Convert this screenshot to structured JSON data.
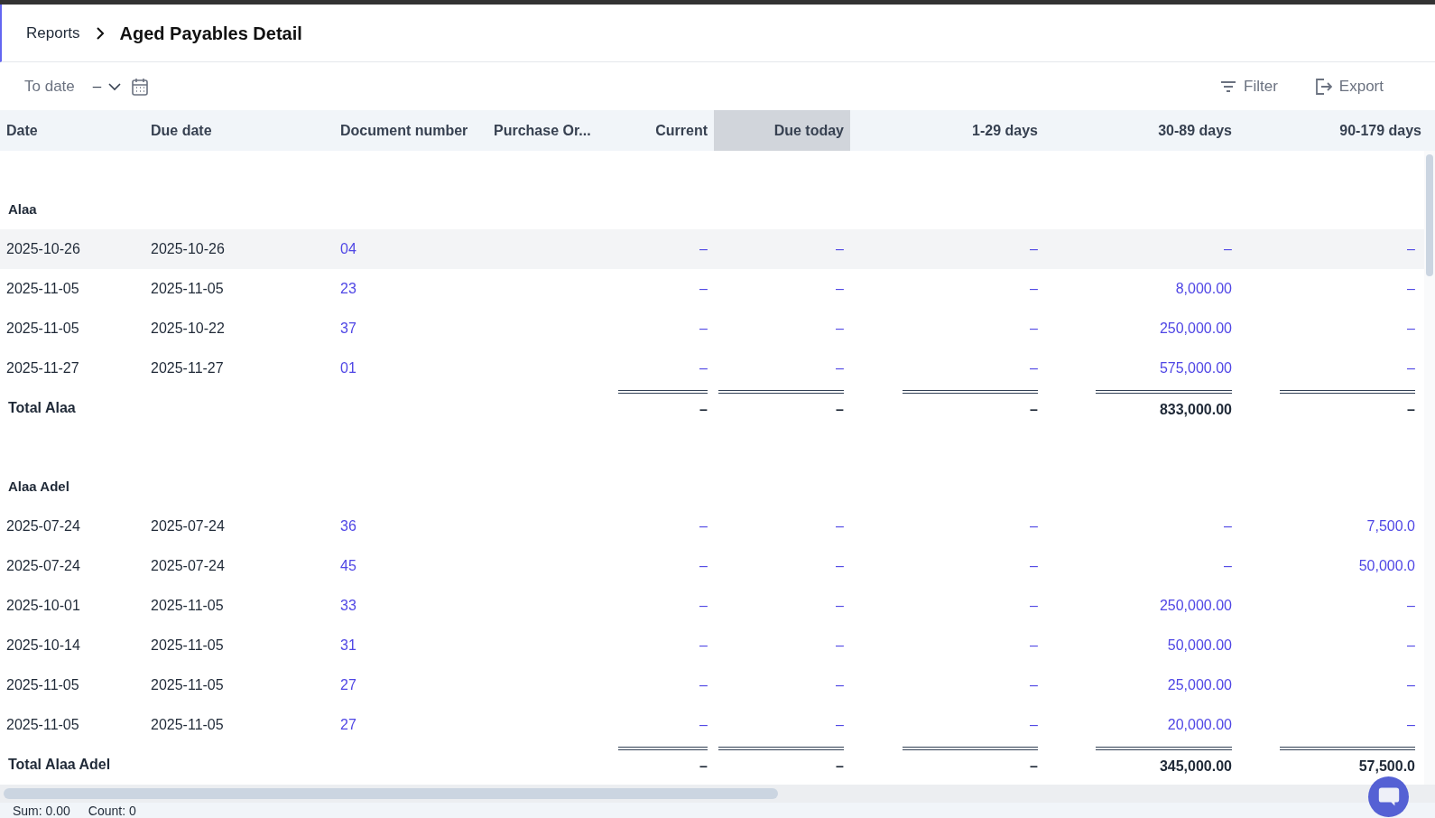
{
  "breadcrumb": {
    "parent": "Reports",
    "current": "Aged Payables Detail"
  },
  "toolbar": {
    "date_label": "To date",
    "date_value": "–",
    "filter": "Filter",
    "export": "Export"
  },
  "table": {
    "columns": [
      {
        "label": "Date",
        "kind": "text",
        "highlighted": false
      },
      {
        "label": "Due date",
        "kind": "text",
        "highlighted": false
      },
      {
        "label": "Document number",
        "kind": "text",
        "highlighted": false
      },
      {
        "label": "Purchase Or...",
        "kind": "text",
        "highlighted": false
      },
      {
        "label": "Current",
        "kind": "amount",
        "highlighted": false
      },
      {
        "label": "Due today",
        "kind": "amount",
        "highlighted": true
      },
      {
        "label": "1-29 days",
        "kind": "amount",
        "highlighted": false
      },
      {
        "label": "30-89 days",
        "kind": "amount",
        "highlighted": false
      },
      {
        "label": "90-179 days",
        "kind": "amount",
        "highlighted": false
      }
    ],
    "groups": [
      {
        "name": "Alaa",
        "rows": [
          {
            "date": "2025-10-26",
            "due_date": "2025-10-26",
            "document_number": "04",
            "selected": true,
            "amounts": [
              "–",
              "–",
              "–",
              "–",
              "–"
            ]
          },
          {
            "date": "2025-11-05",
            "due_date": "2025-11-05",
            "document_number": "23",
            "selected": false,
            "amounts": [
              "–",
              "–",
              "–",
              "8,000.00",
              "–"
            ]
          },
          {
            "date": "2025-11-05",
            "due_date": "2025-10-22",
            "document_number": "37",
            "selected": false,
            "amounts": [
              "–",
              "–",
              "–",
              "250,000.00",
              "–"
            ]
          },
          {
            "date": "2025-11-27",
            "due_date": "2025-11-27",
            "document_number": "01",
            "selected": false,
            "amounts": [
              "–",
              "–",
              "–",
              "575,000.00",
              "–"
            ]
          }
        ],
        "total": {
          "label": "Total Alaa",
          "amounts": [
            "–",
            "–",
            "–",
            "833,000.00",
            "–"
          ]
        }
      },
      {
        "name": "Alaa Adel",
        "rows": [
          {
            "date": "2025-07-24",
            "due_date": "2025-07-24",
            "document_number": "36",
            "selected": false,
            "amounts": [
              "–",
              "–",
              "–",
              "–",
              "7,500.0"
            ]
          },
          {
            "date": "2025-07-24",
            "due_date": "2025-07-24",
            "document_number": "45",
            "selected": false,
            "amounts": [
              "–",
              "–",
              "–",
              "–",
              "50,000.0"
            ]
          },
          {
            "date": "2025-10-01",
            "due_date": "2025-11-05",
            "document_number": "33",
            "selected": false,
            "amounts": [
              "–",
              "–",
              "–",
              "250,000.00",
              "–"
            ]
          },
          {
            "date": "2025-10-14",
            "due_date": "2025-11-05",
            "document_number": "31",
            "selected": false,
            "amounts": [
              "–",
              "–",
              "–",
              "50,000.00",
              "–"
            ]
          },
          {
            "date": "2025-11-05",
            "due_date": "2025-11-05",
            "document_number": "27",
            "selected": false,
            "amounts": [
              "–",
              "–",
              "–",
              "25,000.00",
              "–"
            ]
          },
          {
            "date": "2025-11-05",
            "due_date": "2025-11-05",
            "document_number": "27",
            "selected": false,
            "amounts": [
              "–",
              "–",
              "–",
              "20,000.00",
              "–"
            ]
          }
        ],
        "total": {
          "label": "Total Alaa Adel",
          "amounts": [
            "–",
            "–",
            "–",
            "345,000.00",
            "57,500.0"
          ]
        }
      }
    ]
  },
  "footer": {
    "sum": "Sum: 0.00",
    "count": "Count: 0"
  }
}
